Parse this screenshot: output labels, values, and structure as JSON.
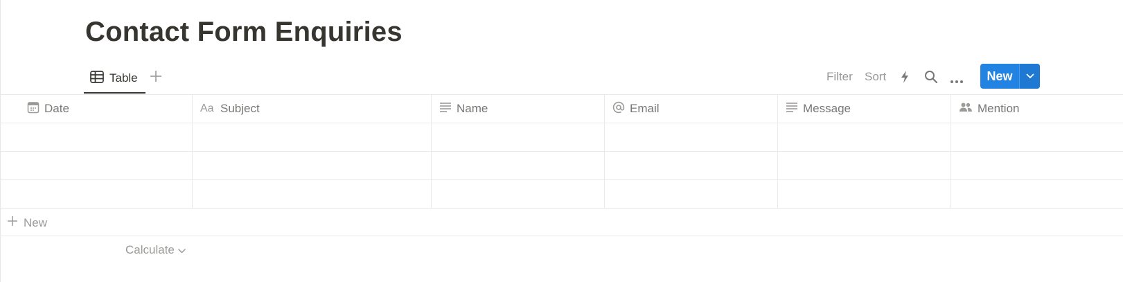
{
  "page": {
    "title": "Contact Form Enquiries"
  },
  "views": {
    "tabs": [
      {
        "label": "Table",
        "icon": "table-icon",
        "active": true
      }
    ],
    "add_view_icon": "plus-icon"
  },
  "toolbar": {
    "filter_label": "Filter",
    "sort_label": "Sort",
    "automation_icon": "lightning-icon",
    "search_icon": "search-icon",
    "more_icon": "more-icon",
    "new_label": "New",
    "new_dropdown_icon": "chevron-down-icon",
    "accent_color": "#2383e2"
  },
  "table": {
    "columns": [
      {
        "label": "Date",
        "icon": "calendar-icon"
      },
      {
        "label": "Subject",
        "icon": "text-aa-icon"
      },
      {
        "label": "Name",
        "icon": "lines-icon"
      },
      {
        "label": "Email",
        "icon": "at-icon"
      },
      {
        "label": "Message",
        "icon": "lines-icon"
      },
      {
        "label": "Mention",
        "icon": "people-icon"
      }
    ],
    "rows": [
      [
        "",
        "",
        "",
        "",
        "",
        ""
      ],
      [
        "",
        "",
        "",
        "",
        "",
        ""
      ],
      [
        "",
        "",
        "",
        "",
        "",
        ""
      ]
    ],
    "add_row_label": "New",
    "calculate_label": "Calculate"
  }
}
